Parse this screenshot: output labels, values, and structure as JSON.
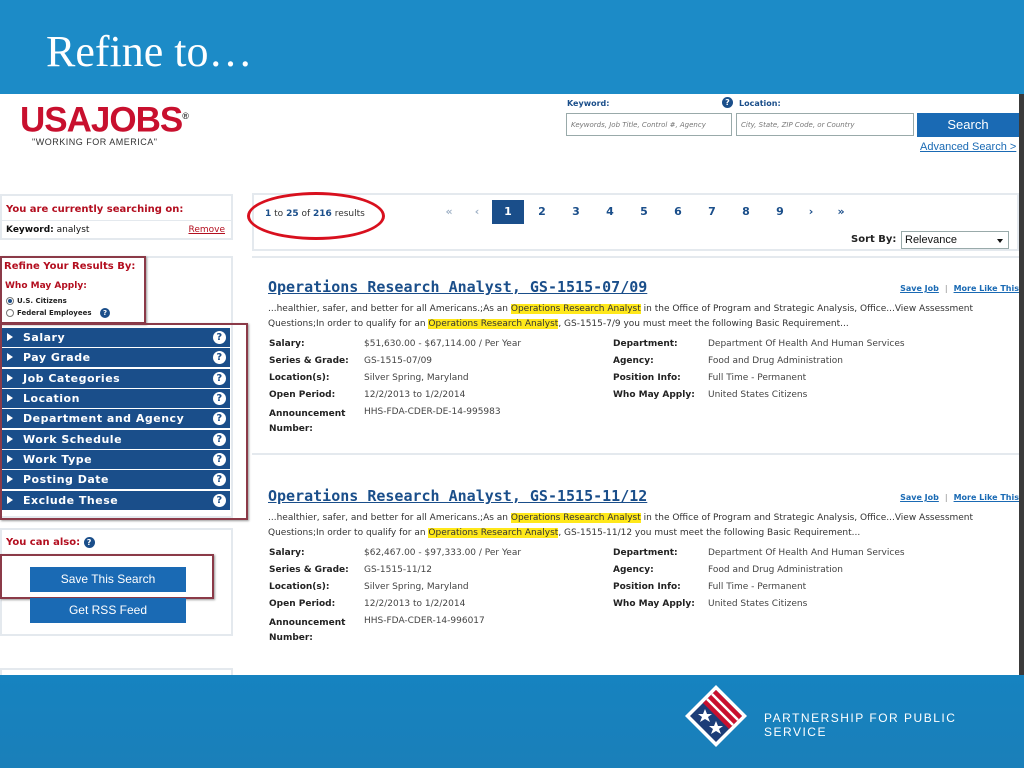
{
  "slide": {
    "title": "Refine to…",
    "footer_org": "PARTNERSHIP FOR PUBLIC SERVICE"
  },
  "logo": {
    "main": "USAJOBS",
    "registered": "®",
    "tagline": "\"WORKING FOR AMERICA\""
  },
  "search": {
    "keyword_label": "Keyword:",
    "keyword_placeholder": "Keywords, Job Title, Control #, Agency",
    "location_label": "Location:",
    "location_placeholder": "City, State, ZIP Code, or Country",
    "button": "Search",
    "advanced": "Advanced Search >"
  },
  "sidebar": {
    "searching_on": "You are currently searching on:",
    "keyword_label": "Keyword:",
    "keyword_value": "analyst",
    "remove": "Remove",
    "refine_heading": "Refine Your Results By:",
    "who_may_apply": "Who May Apply:",
    "options": [
      "U.S. Citizens",
      "Federal Employees"
    ],
    "facets": [
      "Salary",
      "Pay Grade",
      "Job Categories",
      "Location",
      "Department and Agency",
      "Work Schedule",
      "Work Type",
      "Posting Date",
      "Exclude These"
    ],
    "also_heading": "You can also:",
    "save_search": "Save This Search",
    "rss": "Get RSS Feed"
  },
  "results": {
    "from": "1",
    "to_word": "to",
    "to": "25",
    "of_word": "of",
    "total": "216",
    "results_word": "results",
    "pages": [
      "«",
      "‹",
      "1",
      "2",
      "3",
      "4",
      "5",
      "6",
      "7",
      "8",
      "9",
      "›",
      "»"
    ],
    "current_page": "1",
    "sort_label": "Sort By:",
    "sort_value": "Relevance"
  },
  "jobs": [
    {
      "title": "Operations Research Analyst, GS-1515-07/09",
      "save": "Save Job",
      "more": "More Like This",
      "snip_a": "...healthier, safer, and better for all Americans.;As an ",
      "snip_hl1": "Operations Research Analyst",
      "snip_b": " in the Office of Program and Strategic Analysis, Office...View Assessment Questions;In order to qualify for an ",
      "snip_hl2": "Operations Research Analyst",
      "snip_c": ", GS-1515-7/9 you must meet the following Basic Requirement...",
      "salary_label": "Salary:",
      "salary": "$51,630.00 - $67,114.00 / Per Year",
      "series_label": "Series & Grade:",
      "series": "GS-1515-07/09",
      "location_label": "Location(s):",
      "location": "Silver Spring, Maryland",
      "open_label": "Open Period:",
      "open": "12/2/2013 to 1/2/2014",
      "announce_label": "Announcement Number:",
      "announce": "HHS-FDA-CDER-DE-14-995983",
      "dept_label": "Department:",
      "dept": "Department Of Health And Human Services",
      "agency_label": "Agency:",
      "agency": "Food and Drug Administration",
      "position_label": "Position Info:",
      "position": "Full Time - Permanent",
      "who_label": "Who May Apply:",
      "who": "United States Citizens"
    },
    {
      "title": "Operations Research Analyst, GS-1515-11/12",
      "save": "Save Job",
      "more": "More Like This",
      "snip_a": "...healthier, safer, and better for all Americans.;As an ",
      "snip_hl1": "Operations Research Analyst",
      "snip_b": " in the Office of Program and Strategic Analysis, Office...View Assessment Questions;In order to qualify for an ",
      "snip_hl2": "Operations Research Analyst",
      "snip_c": ", GS-1515-11/12 you must meet the following Basic Requirement...",
      "salary_label": "Salary:",
      "salary": "$62,467.00 - $97,333.00 / Per Year",
      "series_label": "Series & Grade:",
      "series": "GS-1515-11/12",
      "location_label": "Location(s):",
      "location": "Silver Spring, Maryland",
      "open_label": "Open Period:",
      "open": "12/2/2013 to 1/2/2014",
      "announce_label": "Announcement Number:",
      "announce": "HHS-FDA-CDER-14-996017",
      "dept_label": "Department:",
      "dept": "Department Of Health And Human Services",
      "agency_label": "Agency:",
      "agency": "Food and Drug Administration",
      "position_label": "Position Info:",
      "position": "Full Time - Permanent",
      "who_label": "Who May Apply:",
      "who": "United States Citizens"
    }
  ],
  "colors": {
    "slide_blue": "#1c8bc7",
    "usajobs_red": "#c8102e",
    "nav_blue": "#1a4e8a",
    "button_blue": "#1a6ab4",
    "highlight_yellow": "#ffe81a",
    "annotation_red": "#d8101e"
  }
}
